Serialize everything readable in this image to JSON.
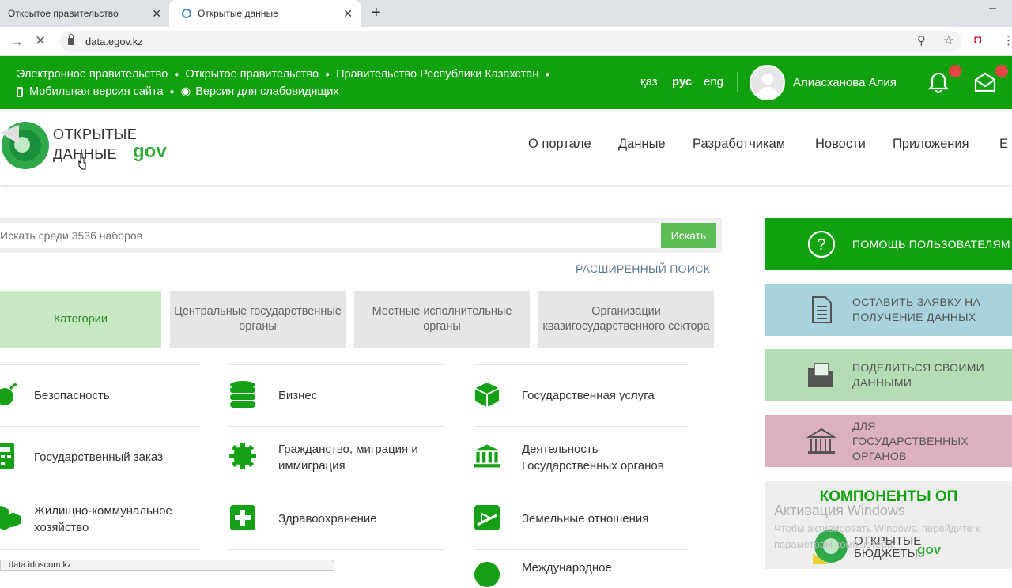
{
  "browser": {
    "tabs": [
      {
        "label": "Открытое правительство"
      },
      {
        "label": "Открытые данные"
      }
    ],
    "url": "data.egov.kz"
  },
  "govbar": {
    "links_row1": [
      "Электронное правительство",
      "Открытое правительство",
      "Правительство Республики Казахстан"
    ],
    "links_row2": [
      "Мобильная версия сайта",
      "Версия для слабовидящих"
    ],
    "languages": [
      "қаз",
      "рус",
      "eng"
    ],
    "active_language": "рус",
    "user_name": "Алиасханова Алия"
  },
  "header": {
    "logo_line1": "ОТКРЫТЫЕ",
    "logo_line2": "ДАННЫЕ",
    "logo_gov": "gov",
    "menu": [
      "О портале",
      "Данные",
      "Разработчикам",
      "Новости",
      "Приложения",
      "Е"
    ]
  },
  "search": {
    "placeholder": "Искать среди 3536 наборов",
    "button": "Искать",
    "advanced": "РАСШИРЕННЫЙ ПОИСК"
  },
  "category_tabs": [
    {
      "label": "Категории",
      "active": true
    },
    {
      "label": "Центральные государственные органы"
    },
    {
      "label": "Местные исполнительные органы"
    },
    {
      "label": "Организации квазигосударственного сектора"
    }
  ],
  "categories": [
    {
      "label": "Безопасность",
      "icon": "bomb-icon"
    },
    {
      "label": "Бизнес",
      "icon": "database-icon"
    },
    {
      "label": "Государственная услуга",
      "icon": "cube-icon"
    },
    {
      "label": "Государственный заказ",
      "icon": "calculator-icon"
    },
    {
      "label": "Гражданство, миграция и иммиграция",
      "icon": "gear-icon"
    },
    {
      "label": "Деятельность Государственных органов",
      "icon": "bank-icon"
    },
    {
      "label": "Жилищно-коммунальное хозяйство",
      "icon": "cubes-icon"
    },
    {
      "label": "Здравоохранение",
      "icon": "plus-square-icon"
    },
    {
      "label": "Земельные отношения",
      "icon": "land-icon"
    },
    {
      "label": "Международное",
      "icon": "globe-icon"
    }
  ],
  "sidebar": {
    "items": [
      {
        "label": "ПОМОЩЬ ПОЛЬЗОВАТЕЛЯМ",
        "icon": "question-icon",
        "bg": "#11a10f",
        "color": "#ffffff"
      },
      {
        "label": "ОСТАВИТЬ ЗАЯВКУ НА ПОЛУЧЕНИЕ ДАННЫХ",
        "icon": "document-icon",
        "bg": "#a9d3dc",
        "color": "#555555"
      },
      {
        "label": "ПОДЕЛИТЬСЯ СВОИМИ ДАННЫМИ",
        "icon": "folder-icon",
        "bg": "#b5dcb5",
        "color": "#555555"
      },
      {
        "label": "ДЛЯ ГОСУДАРСТВЕННЫХ ОРГАНОВ",
        "icon": "government-building-icon",
        "bg": "#dcb0bd",
        "color": "#555555"
      }
    ],
    "components_title": "КОМПОНЕНТЫ ОП",
    "budget_logo_line1": "ОТКРЫТЫЕ",
    "budget_logo_line2": "БЮДЖЕТЫ",
    "budget_logo_gov": "gov"
  },
  "watermark": {
    "title": "Активация Windows",
    "line1": "Чтобы активировать Windows, перейдите к",
    "line2": "параметрам компьютера."
  },
  "status_url": "data.idoscom.kz",
  "colors": {
    "gov_green": "#11a10f",
    "accent_green": "#15a015"
  }
}
